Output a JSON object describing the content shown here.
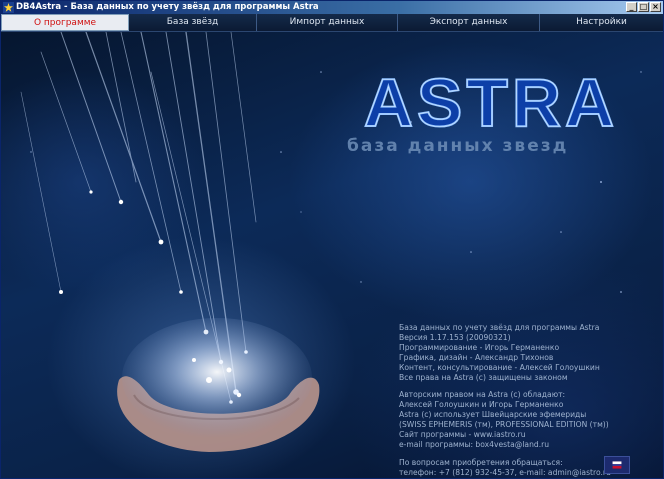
{
  "window": {
    "title": "DB4Astra - База данных по учету звёзд для программы Astra",
    "icon": "astra-app-icon",
    "controls": {
      "minimize": "_",
      "maximize": "□",
      "close": "×"
    }
  },
  "tabs": [
    {
      "label": "О программе",
      "active": true
    },
    {
      "label": "База звёзд",
      "active": false
    },
    {
      "label": "Импорт данных",
      "active": false
    },
    {
      "label": "Экспорт данных",
      "active": false
    },
    {
      "label": "Настройки",
      "active": false
    }
  ],
  "splash": {
    "logo": "ASTRA",
    "subtitle": "база данных звезд"
  },
  "info": {
    "block1": [
      "База данных по учету звёзд для программы Astra",
      "Версия 1.17.153 (20090321)",
      "Программирование - Игорь Германенко",
      "Графика, дизайн - Александр Тихонов",
      "Контент, консультирование - Алексей Голоушкин",
      "Все права на Astra (с) защищены законом"
    ],
    "block2": [
      "Авторским правом на Astra (с) обладают:",
      "Алексей Голоушкин и Игорь Германенко",
      "Astra (с) использует Швейцарские эфемериды",
      "(SWISS EPHEMERIS (тм), PROFESSIONAL EDITION (тм))",
      "Сайт программы - www.iastro.ru",
      "e-mail программы: box4vesta@land.ru"
    ],
    "block3": [
      "По вопросам приобретения обращаться:",
      "телефон: +7 (812) 932-45-37, e-mail: admin@iastro.ru"
    ]
  },
  "colors": {
    "active_tab_text": "#d01010",
    "logo_blue": "#1f5fd6",
    "info_text": "#9fb3cf"
  }
}
